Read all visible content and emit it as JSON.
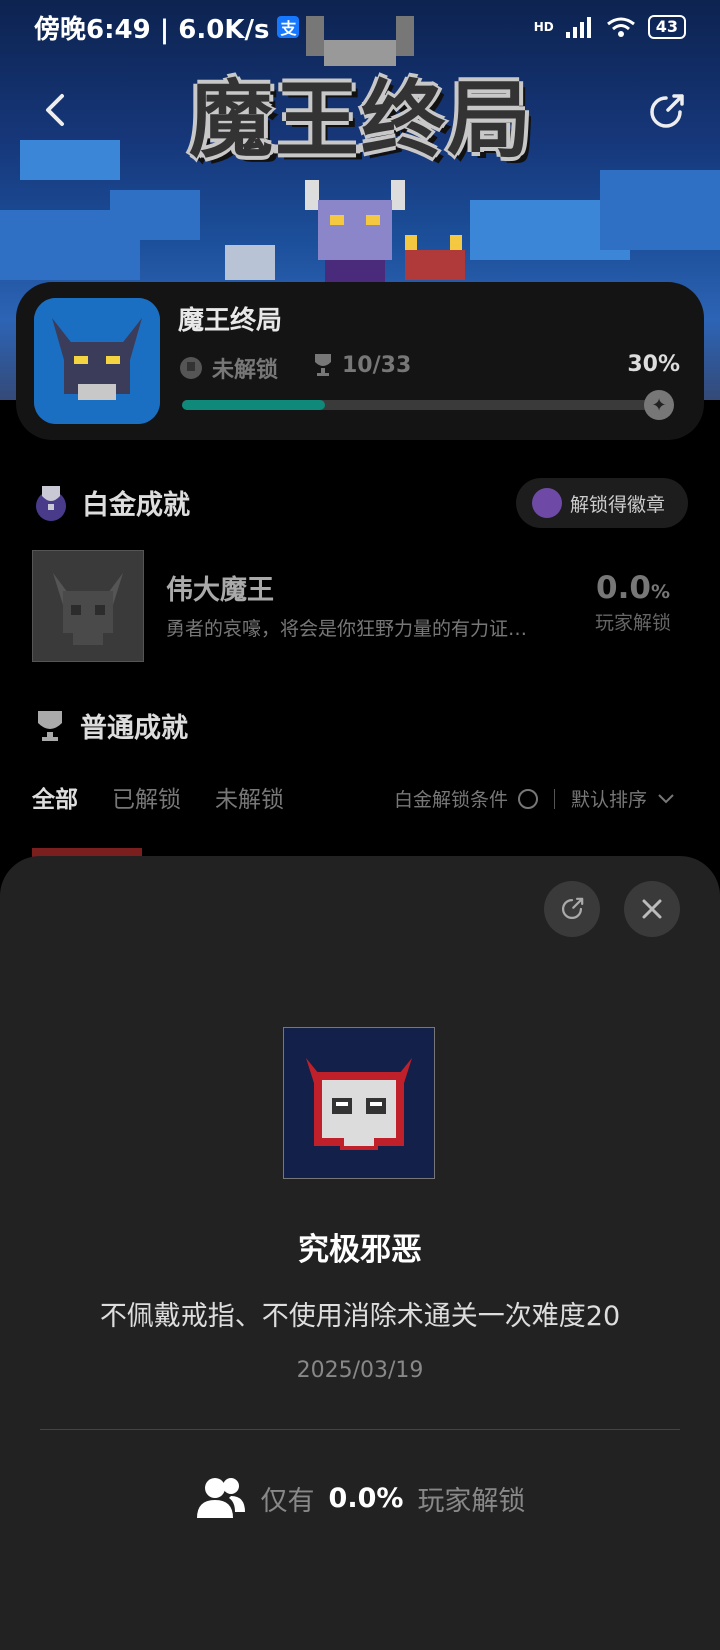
{
  "status_bar": {
    "time": "傍晚6:49 | 6.0K/s",
    "pay_icon": "支",
    "hd": "HD",
    "battery": "43"
  },
  "hero": {
    "title": "魔王终局"
  },
  "game": {
    "name": "魔王终局",
    "lock_state": "未解锁",
    "trophy_count": "10/33",
    "percent": "30%",
    "progress": 0.3
  },
  "platinum": {
    "section_title": "白金成就",
    "badge_button": "解锁得徽章",
    "item": {
      "title": "伟大魔王",
      "desc": "勇者的哀嚎，将会是你狂野力量的有力证…",
      "pct_value": "0.0",
      "pct_unit": "%",
      "pct_label": "玩家解锁"
    }
  },
  "normal": {
    "section_title": "普通成就",
    "tabs": [
      "全部",
      "已解锁",
      "未解锁"
    ],
    "filter_label": "白金解锁条件",
    "sort_label": "默认排序"
  },
  "sheet": {
    "title": "究极邪恶",
    "desc": "不佩戴戒指、不使用消除术通关一次难度20",
    "date": "2025/03/19",
    "only_prefix": "仅有",
    "only_value": "0.0%",
    "only_suffix": "玩家解锁"
  },
  "colors": {
    "accent": "#0f8a7a",
    "sheet_bg": "#222222",
    "card_bg": "#141414"
  }
}
